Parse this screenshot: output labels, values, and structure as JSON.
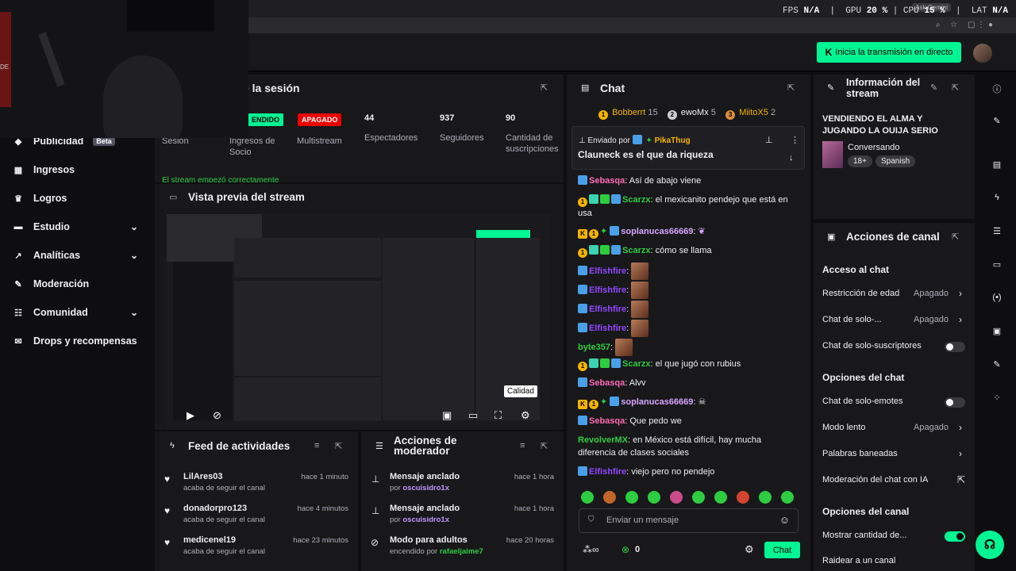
{
  "stats": {
    "fps_label": "FPS",
    "fps": "N/A",
    "gpu_label": "GPU",
    "gpu": "20 %",
    "cpu_label": "CPU",
    "cpu": "15 %",
    "lat_label": "LAT",
    "lat": "N/A",
    "ask": "Ask Gemini"
  },
  "webcam": {
    "text": "DE"
  },
  "topbar": {
    "go_live": "Inicia la transmisión en directo",
    "go_live_icon": "K"
  },
  "sidebar": {
    "items": [
      {
        "label": "Publicidad",
        "badge": "Beta",
        "icon": "megaphone-icon"
      },
      {
        "label": "Ingresos",
        "icon": "chart-icon"
      },
      {
        "label": "Logros",
        "icon": "trophy-icon"
      },
      {
        "label": "Estudio",
        "icon": "studio-icon",
        "expand": true
      },
      {
        "label": "Analíticas",
        "icon": "analytics-icon",
        "expand": true
      },
      {
        "label": "Moderación",
        "icon": "wrench-icon"
      },
      {
        "label": "Comunidad",
        "icon": "community-icon",
        "expand": true
      },
      {
        "label": "Drops y recompensas",
        "icon": "gift-icon"
      }
    ]
  },
  "session": {
    "title": "n de la sesión",
    "col1_label": "Sesión",
    "col2_tag": "ENDIDO",
    "col2_label": "Ingresos de Socio",
    "col3_tag": "APAGADO",
    "col3_label": "Multistream",
    "viewers": "44",
    "viewers_label": "Espectadores",
    "followers": "937",
    "followers_label": "Seguidores",
    "subs": "90",
    "subs_label": "Cantidad de suscripciones",
    "notice": "El stream empezó correctamente"
  },
  "preview": {
    "title": "Vista previa del stream",
    "quality_tooltip": "Calidad"
  },
  "feed": {
    "title": "Feed de actividades",
    "items": [
      {
        "name": "LilAres03",
        "sub": "acaba de seguir el canal",
        "time": "hace 1 minuto"
      },
      {
        "name": "donadorpro123",
        "sub": "acaba de seguir el canal",
        "time": "hace 4 minutos"
      },
      {
        "name": "medicenel19",
        "sub": "acaba de seguir el canal",
        "time": "hace 23 minutos"
      }
    ]
  },
  "mod": {
    "title": "Acciones de moderador",
    "items": [
      {
        "name": "Mensaje anclado",
        "sub_pre": "por",
        "sub_user": "oscuisidro1x",
        "time": "hace 1 hora"
      },
      {
        "name": "Mensaje anclado",
        "sub_pre": "por",
        "sub_user": "oscuisidro1x",
        "time": "hace 1 hora"
      },
      {
        "name": "Modo para adultos",
        "sub_pre": "encendido por",
        "sub_user": "rafaeljaime7",
        "time": "hace 20 horas"
      }
    ]
  },
  "chat": {
    "title": "Chat",
    "leaders": [
      {
        "rank": "1",
        "name": "Bobberrt",
        "score": "15"
      },
      {
        "rank": "2",
        "name": "ewoMx",
        "score": "5"
      },
      {
        "rank": "3",
        "name": "MiitoX5",
        "score": "2"
      }
    ],
    "pinned": {
      "by": "Enviado por",
      "user": "PikaThug",
      "text": "Clauneck es el que da riqueza"
    },
    "messages": [
      {
        "user": "Sebasqa",
        "color": "#ff69b4",
        "text": "Así de abajo viene"
      },
      {
        "user": "Scarzx",
        "color": "#2ecc40",
        "text": "el mexicanito pendejo que está en usa"
      },
      {
        "user": "soplanucas66669",
        "color": "#d7a6ff",
        "text": ""
      },
      {
        "user": "Scarzx",
        "color": "#2ecc40",
        "text": "cómo se llama"
      },
      {
        "user": "Elfishfire",
        "color": "#9147ff",
        "text": ""
      },
      {
        "user": "Elfishfire",
        "color": "#9147ff",
        "text": ""
      },
      {
        "user": "Elfishfire",
        "color": "#9147ff",
        "text": ""
      },
      {
        "user": "Elfishfire",
        "color": "#9147ff",
        "text": ""
      },
      {
        "user": "byte357",
        "color": "#2ecc40",
        "text": ""
      },
      {
        "user": "Scarzx",
        "color": "#2ecc40",
        "text": "el que jugó con rubius"
      },
      {
        "user": "Sebasqa",
        "color": "#ff69b4",
        "text": "Alvv"
      },
      {
        "user": "soplanucas66669",
        "color": "#d7a6ff",
        "text": ""
      },
      {
        "user": "Sebasqa",
        "color": "#ff69b4",
        "text": "Que pedo we"
      },
      {
        "user": "RevolverMX",
        "color": "#2ecc40",
        "text": "en México está difícil, hay mucha diferencia de clases sociales"
      },
      {
        "user": "Elfishfire",
        "color": "#9147ff",
        "text": "viejo pero no pendejo"
      }
    ],
    "input_placeholder": "Enviar un mensaje",
    "points": "0",
    "send": "Chat"
  },
  "info": {
    "title": "Información del stream",
    "stream_title": "VENDIENDO EL ALMA Y JUGANDO LA OUIJA SERIO",
    "category": "Conversando",
    "tags": [
      "18+",
      "Spanish"
    ]
  },
  "actions": {
    "title": "Acciones de canal",
    "sec1": "Acceso al chat",
    "age": "Restricción de edad",
    "age_val": "Apagado",
    "solo": "Chat de solo-...",
    "solo_val": "Apagado",
    "subs": "Chat de solo-suscriptores",
    "sec2": "Opciones del chat",
    "emotes": "Chat de solo-emotes",
    "slow": "Modo lento",
    "slow_val": "Apagado",
    "banned": "Palabras baneadas",
    "ai": "Moderación del chat con IA",
    "sec3": "Opciones del canal",
    "show_count": "Mostrar cantidad de...",
    "raid": "Raidear a un canal"
  }
}
